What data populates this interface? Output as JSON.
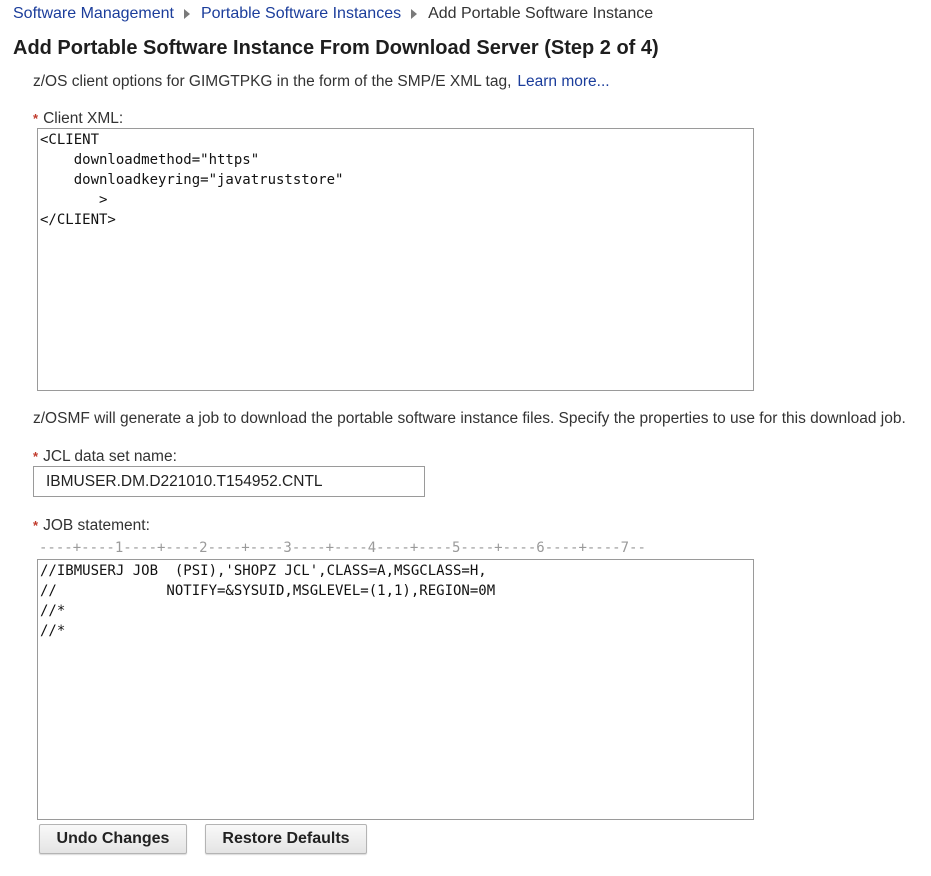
{
  "breadcrumb": {
    "items": [
      {
        "label": "Software Management"
      },
      {
        "label": "Portable Software Instances"
      },
      {
        "label": "Add Portable Software Instance"
      }
    ]
  },
  "page": {
    "title": "Add Portable Software Instance From Download Server (Step 2 of 4)"
  },
  "client_options": {
    "intro": "z/OS client options for GIMGTPKG in the form of the SMP/E XML tag,",
    "learn_more": "Learn more...",
    "client_xml_label": "Client XML:",
    "client_xml_value": "<CLIENT\n    downloadmethod=\"https\"\n    downloadkeyring=\"javatruststore\"\n       >\n</CLIENT>"
  },
  "download_job": {
    "intro": "z/OSMF will generate a job to download the portable software instance files. Specify the properties to use for this download job.",
    "jcl_label": "JCL data set name:",
    "jcl_value": "IBMUSER.DM.D221010.T154952.CNTL",
    "job_label": "JOB statement:",
    "ruler": "----+----1----+----2----+----3----+----4----+----5----+----6----+----7--",
    "job_value": "//IBMUSERJ JOB  (PSI),'SHOPZ JCL',CLASS=A,MSGCLASS=H,\n//             NOTIFY=&SYSUID,MSGLEVEL=(1,1),REGION=0M\n//*\n//*"
  },
  "buttons": {
    "undo": "Undo Changes",
    "restore": "Restore Defaults"
  },
  "required_marker": "*",
  "colors": {
    "link": "#1b3d9b",
    "required": "#c0392b"
  },
  "icons": {
    "breadcrumb_separator": "chevron-right-icon",
    "required": "asterisk-icon"
  }
}
